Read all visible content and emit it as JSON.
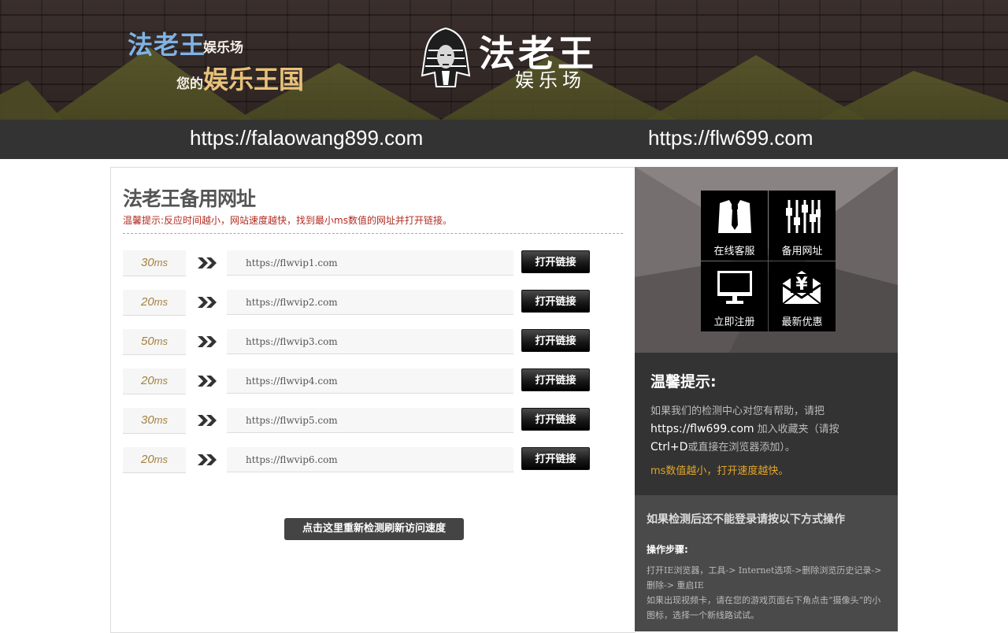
{
  "banner": {
    "slogan_big1": "法老王",
    "slogan_small1": "娱乐场",
    "slogan_small2": "您的",
    "slogan_big2": "娱乐王国",
    "logo_title": "法老王",
    "logo_sub": "娱乐场"
  },
  "urlbar": {
    "url_left": "https://falaowang899.com",
    "url_right": "https://flw699.com"
  },
  "main": {
    "title": "法老王备用网址",
    "tip": "温馨提示:反应时间越小，网站速度越快，找到最小ms数值的网址并打开链接。",
    "unit": "ms",
    "rows": [
      {
        "ms": "30",
        "url": "https://flwvip1.com",
        "button": "打开链接"
      },
      {
        "ms": "20",
        "url": "https://flwvip2.com",
        "button": "打开链接"
      },
      {
        "ms": "50",
        "url": "https://flwvip3.com",
        "button": "打开链接"
      },
      {
        "ms": "20",
        "url": "https://flwvip4.com",
        "button": "打开链接"
      },
      {
        "ms": "30",
        "url": "https://flwvip5.com",
        "button": "打开链接"
      },
      {
        "ms": "20",
        "url": "https://flwvip6.com",
        "button": "打开链接"
      }
    ],
    "retest_button": "点击这里重新检测刷新访问速度"
  },
  "sidebar": {
    "tiles": [
      {
        "label": "在线客服",
        "icon": "suit-icon"
      },
      {
        "label": "备用网址",
        "icon": "sliders-icon"
      },
      {
        "label": "立即注册",
        "icon": "monitor-icon"
      },
      {
        "label": "最新优惠",
        "icon": "yen-envelope-icon"
      }
    ],
    "notice_title": "温馨提示:",
    "notice_line1": "如果我们的检测中心对您有帮助，请把",
    "notice_url": "https://flw699.com",
    "notice_line2": " 加入收藏夹（请按",
    "notice_key": "Ctrl+D",
    "notice_line3": "或直接在浏览器添加）。",
    "notice_highlight": "ms数值越小，打开速度越快。",
    "help_title": "如果检测后还不能登录请按以下方式操作",
    "steps_label": "操作步骤:",
    "steps_text1": "打开IE浏览器，工具-> Internet选项->删除浏览历史记录-> 删除-> 重启IE",
    "steps_text2": "如果出现视频卡，请在您的游戏页面右下角点击“摄像头”的小图标，选择一个新线路试试。"
  },
  "colors": {
    "accent_orange": "#e3a528",
    "tip_red": "#b22a1f",
    "ms_gold": "#a4813e",
    "dark_bar": "#333333"
  }
}
